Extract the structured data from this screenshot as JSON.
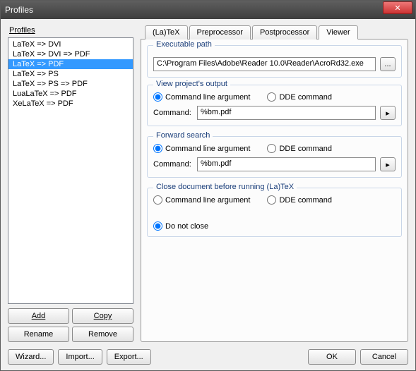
{
  "window": {
    "title": "Profiles"
  },
  "left": {
    "label": "Profiles",
    "items": [
      "LaTeX => DVI",
      "LaTeX => DVI => PDF",
      "LaTeX => PDF",
      "LaTeX => PS",
      "LaTeX => PS => PDF",
      "LuaLaTeX => PDF",
      "XeLaTeX => PDF"
    ],
    "selected_index": 2,
    "buttons": {
      "add": "Add",
      "copy": "Copy",
      "rename": "Rename",
      "remove": "Remove"
    }
  },
  "tabs": {
    "items": [
      "(La)TeX",
      "Preprocessor",
      "Postprocessor",
      "Viewer"
    ],
    "active_index": 3
  },
  "exec": {
    "group": "Executable path",
    "value": "C:\\Program Files\\Adobe\\Reader 10.0\\Reader\\AcroRd32.exe",
    "browse": "..."
  },
  "view": {
    "group": "View project's output",
    "radio_cmd": "Command line argument",
    "radio_dde": "DDE command",
    "command_label": "Command:",
    "command_value": "%bm.pdf",
    "arrow": "▸"
  },
  "forward": {
    "group": "Forward search",
    "radio_cmd": "Command line argument",
    "radio_dde": "DDE command",
    "command_label": "Command:",
    "command_value": "%bm.pdf",
    "arrow": "▸"
  },
  "close": {
    "group": "Close document before running (La)TeX",
    "radio_cmd": "Command line argument",
    "radio_dde": "DDE command",
    "radio_none": "Do not close"
  },
  "footer": {
    "wizard": "Wizard...",
    "import": "Import...",
    "export": "Export...",
    "ok": "OK",
    "cancel": "Cancel"
  }
}
